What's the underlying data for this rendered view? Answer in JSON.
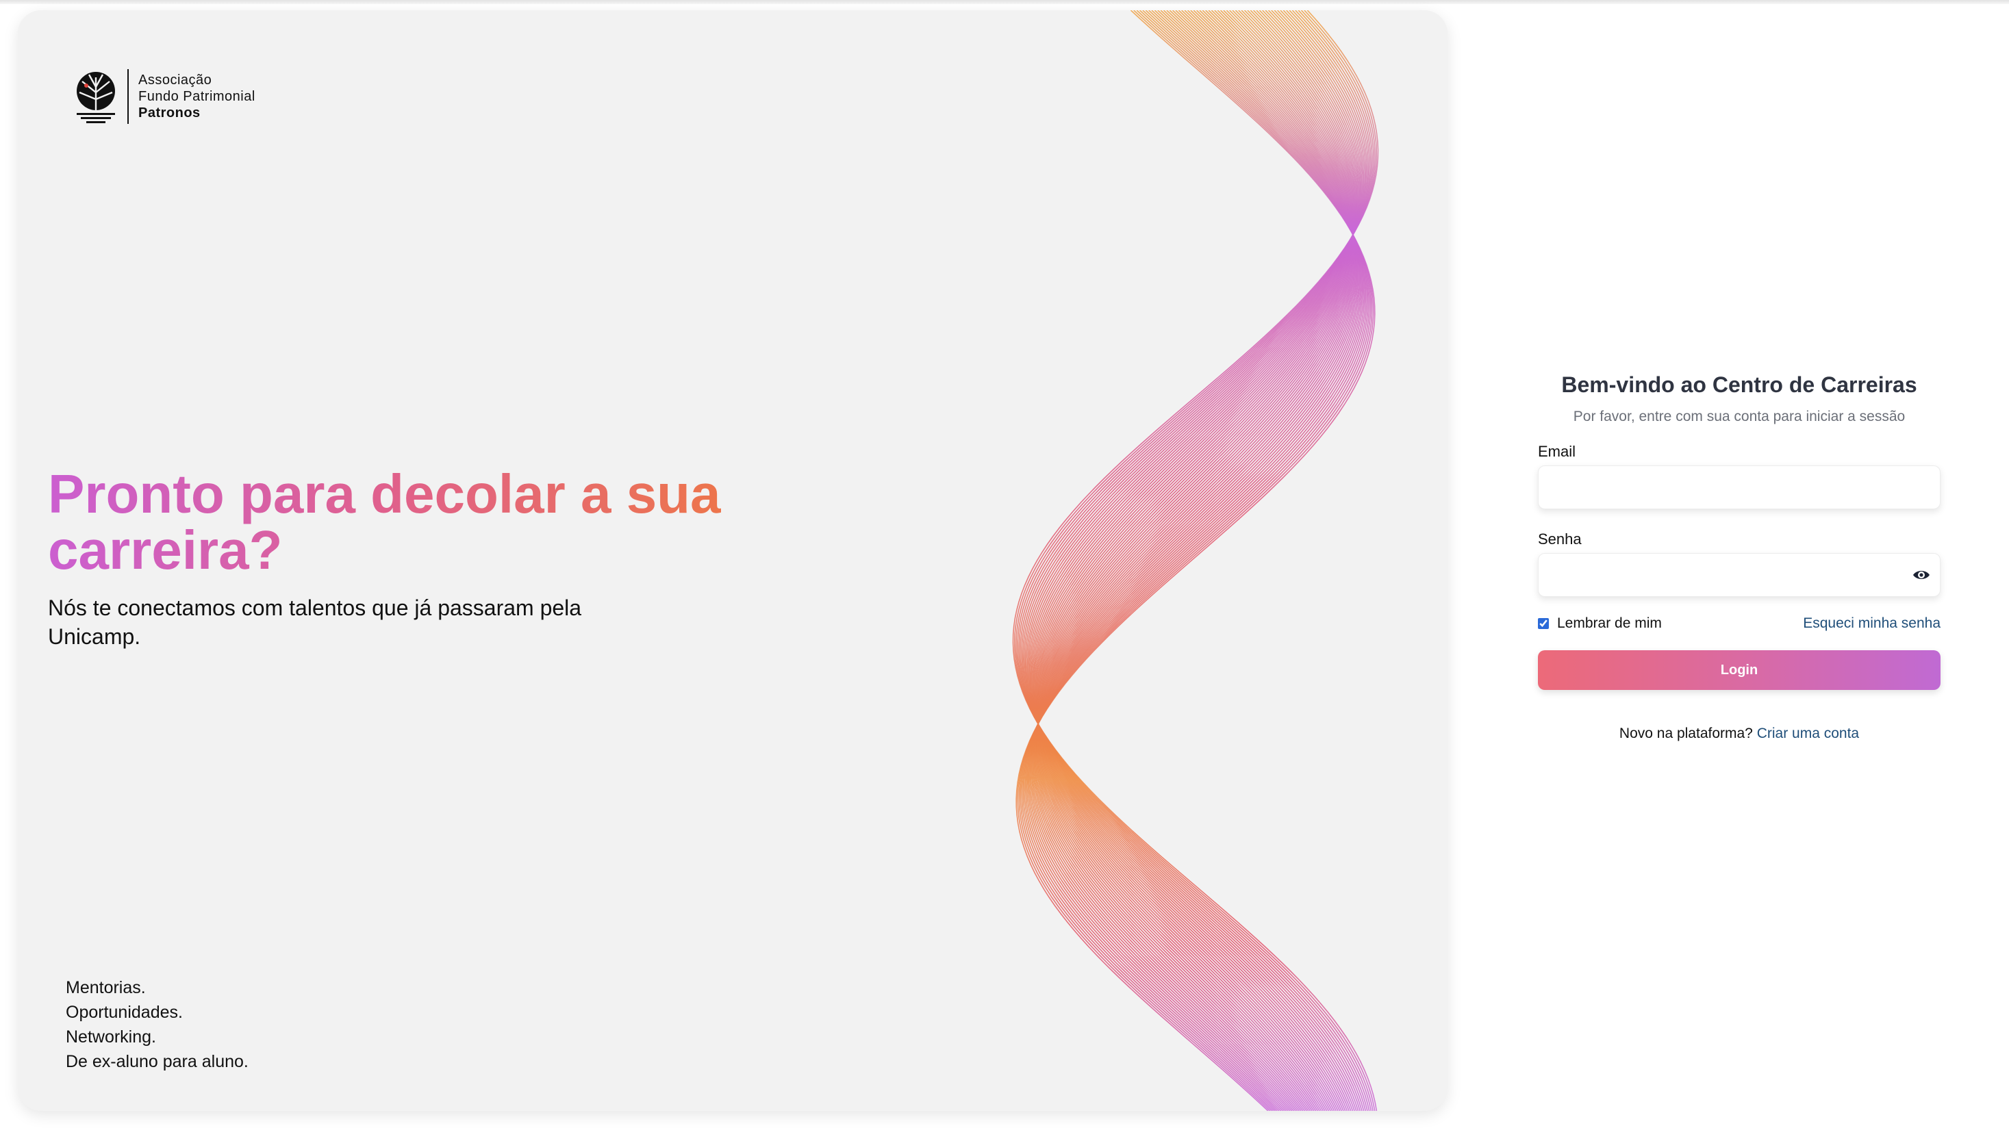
{
  "logo": {
    "line1": "Associação",
    "line2": "Fundo Patrimonial",
    "line3": "Patronos"
  },
  "hero": {
    "headline": "Pronto para decolar a sua carreira?",
    "subtitle": "Nós te conectamos com talentos que já passaram pela Unicamp.",
    "features": [
      "Mentorias.",
      "Oportunidades.",
      "Networking.",
      "De ex-aluno para aluno."
    ]
  },
  "login": {
    "title": "Bem-vindo ao Centro de Carreiras",
    "subtitle": "Por favor, entre com sua conta para iniciar a sessão",
    "email_label": "Email",
    "email_value": "",
    "password_label": "Senha",
    "password_value": "",
    "remember_label": "Lembrar de mim",
    "remember_checked": true,
    "forgot_label": "Esqueci minha senha",
    "login_button": "Login",
    "signup_prompt": "Novo na plataforma?",
    "signup_link": "Criar uma conta"
  },
  "colors": {
    "gradient_pink": "#cb5fd0",
    "gradient_rose": "#e0608c",
    "gradient_orange": "#f07a3c",
    "link": "#1f4e79",
    "panel_bg": "#f2f2f2"
  },
  "icons": {
    "password_toggle": "eye-icon",
    "logo": "tree-logo-icon"
  }
}
